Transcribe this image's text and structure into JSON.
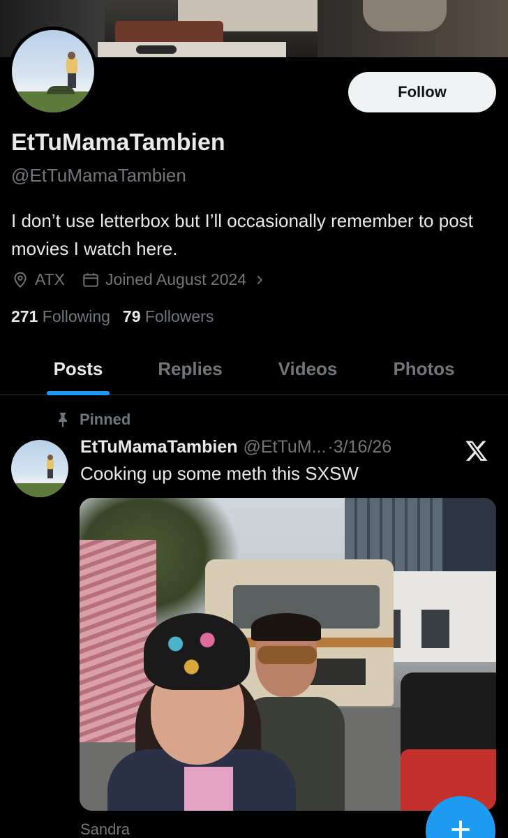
{
  "profile": {
    "display_name": "EtTuMamaTambien",
    "handle": "@EtTuMamaTambien",
    "bio": "I don’t use letterbox but I’ll occasionally remember to post movies I watch here.",
    "location": "ATX",
    "joined": "Joined August 2024",
    "following_count": "271",
    "following_label": "Following",
    "followers_count": "79",
    "followers_label": "Followers",
    "follow_button": "Follow"
  },
  "tabs": [
    {
      "label": "Posts",
      "active": true
    },
    {
      "label": "Replies",
      "active": false
    },
    {
      "label": "Videos",
      "active": false
    },
    {
      "label": "Photos",
      "active": false
    }
  ],
  "post": {
    "pinned_label": "Pinned",
    "author_name": "EtTuMamaTambien",
    "author_handle": "@EtTuM...",
    "separator": "·",
    "date": "3/16/26",
    "text": "Cooking up some meth this SXSW",
    "caption": "Sandra"
  },
  "icons": {
    "location": "location-pin-icon",
    "calendar": "calendar-icon",
    "chevron": "chevron-right-icon",
    "pin": "pin-icon",
    "x_logo": "x-logo-icon",
    "compose": "plus-icon"
  },
  "colors": {
    "background": "#000000",
    "primary_text": "#e7e9ea",
    "secondary_text": "#71767b",
    "accent": "#1d9bf0",
    "follow_button_bg": "#eff3f4"
  }
}
